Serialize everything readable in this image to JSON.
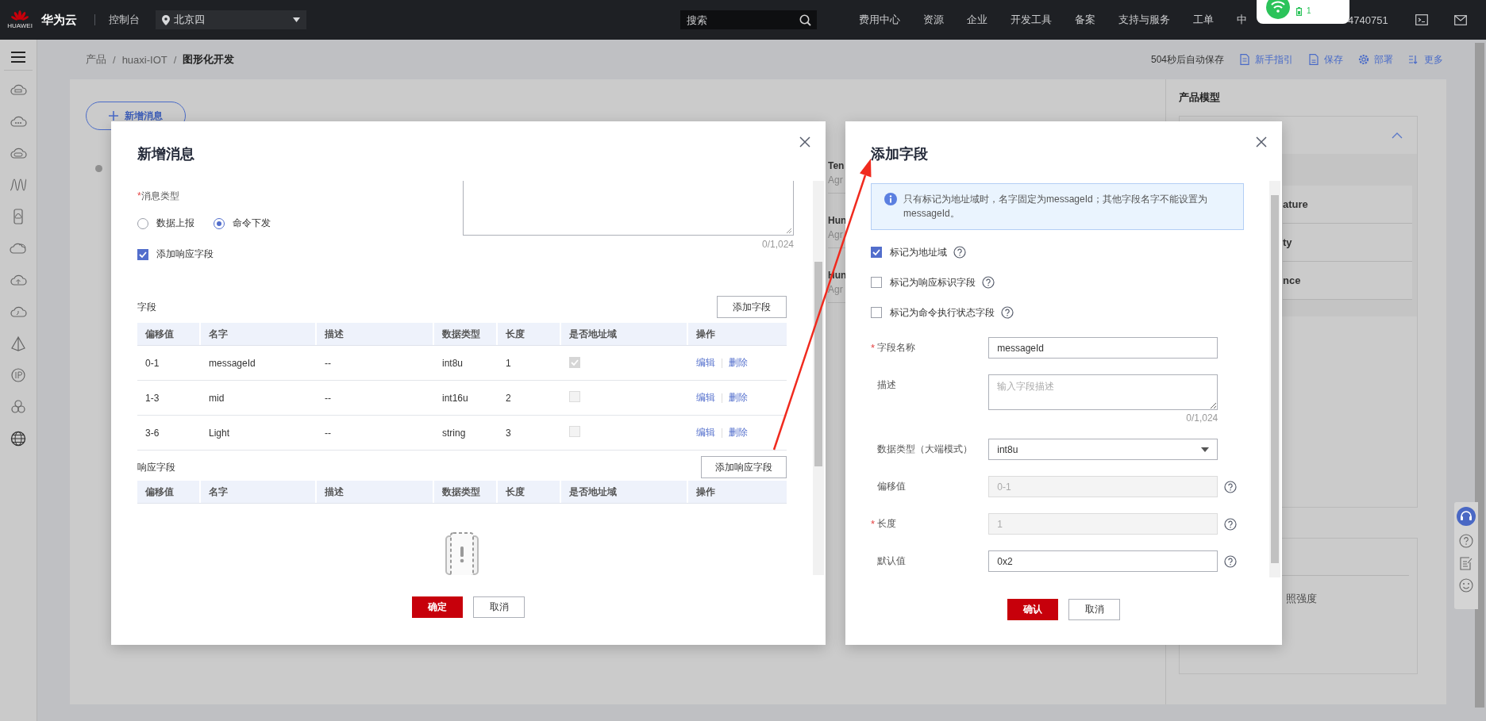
{
  "top_bar": {
    "logo_caption": "HUAWEI",
    "brand": "华为云",
    "console": "控制台",
    "region": "北京四",
    "search_placeholder": "搜索",
    "links": [
      "费用中心",
      "资源",
      "企业",
      "开发工具",
      "备案",
      "支持与服务",
      "工单",
      "中"
    ],
    "account": "4740751"
  },
  "status_popup": {
    "count": "1"
  },
  "breadcrumb": {
    "separator": "/",
    "items": [
      "产品",
      "huaxi-IOT",
      "图形化开发"
    ]
  },
  "toolbar": {
    "autosave": "504秒后自动保存",
    "actions": [
      {
        "kind": "guide",
        "label": "新手指引"
      },
      {
        "kind": "save",
        "label": "保存"
      },
      {
        "kind": "deploy",
        "label": "部署"
      },
      {
        "kind": "more",
        "label": "更多"
      }
    ]
  },
  "canvas": {
    "add_message_button": "新增消息",
    "message_cards": [
      {
        "title": "Ten",
        "subtitle": "Agr"
      },
      {
        "title": "Hun",
        "subtitle": "Agr"
      },
      {
        "title": "Hun",
        "subtitle": "Agr"
      }
    ]
  },
  "product_model": {
    "title": "产品模型",
    "expanded": true,
    "properties": [
      "ature",
      "ty",
      "nce"
    ],
    "second_section_item": "照强度"
  },
  "message_dialog": {
    "title": "新增消息",
    "type_label": "消息类型",
    "required_mark": "*",
    "types": [
      {
        "label": "数据上报",
        "selected": false
      },
      {
        "label": "命令下发",
        "selected": true
      }
    ],
    "add_response": {
      "label": "添加响应字段",
      "checked": true
    },
    "description_counter": "0/1,024",
    "fields": {
      "label": "字段",
      "add_button": "添加字段",
      "columns": [
        "偏移值",
        "名字",
        "描述",
        "数据类型",
        "长度",
        "是否地址域",
        "操作"
      ],
      "rows": [
        {
          "offset": "0-1",
          "name": "messageId",
          "description": "--",
          "data_type": "int8u",
          "length": "1",
          "is_address": true,
          "disabled": true,
          "actions": [
            "编辑",
            "删除"
          ]
        },
        {
          "offset": "1-3",
          "name": "mid",
          "description": "--",
          "data_type": "int16u",
          "length": "2",
          "is_address": false,
          "disabled": true,
          "actions": [
            "编辑",
            "删除"
          ]
        },
        {
          "offset": "3-6",
          "name": "Light",
          "description": "--",
          "data_type": "string",
          "length": "3",
          "is_address": false,
          "disabled": true,
          "actions": [
            "编辑",
            "删除"
          ]
        }
      ]
    },
    "response_fields": {
      "label": "响应字段",
      "add_button": "添加响应字段",
      "columns": [
        "偏移值",
        "名字",
        "描述",
        "数据类型",
        "长度",
        "是否地址域",
        "操作"
      ]
    },
    "buttons": {
      "ok": "确定",
      "cancel": "取消"
    }
  },
  "field_dialog": {
    "title": "添加字段",
    "notice": "只有标记为地址域时，名字固定为messageId；其他字段名字不能设置为messageId。",
    "options": [
      {
        "label": "标记为地址域",
        "checked": true
      },
      {
        "label": "标记为响应标识字段",
        "checked": false
      },
      {
        "label": "标记为命令执行状态字段",
        "checked": false
      }
    ],
    "form": [
      {
        "kind": "input",
        "label": "字段名称",
        "required_mark": "*",
        "value": "messageId",
        "disabled": false
      },
      {
        "kind": "textarea",
        "label": "描述",
        "placeholder": "输入字段描述",
        "counter": "0/1,024"
      },
      {
        "kind": "select",
        "label": "数据类型（大端模式）",
        "value": "int8u"
      },
      {
        "kind": "input",
        "label": "偏移值",
        "value": "0-1",
        "disabled": true,
        "help": true
      },
      {
        "kind": "input",
        "label": "长度",
        "required_mark": "*",
        "value": "1",
        "disabled": true,
        "help": true
      },
      {
        "kind": "input",
        "label": "默认值",
        "value": "0x2",
        "disabled": false,
        "help": true
      }
    ],
    "buttons": {
      "ok": "确认",
      "cancel": "取消"
    }
  }
}
